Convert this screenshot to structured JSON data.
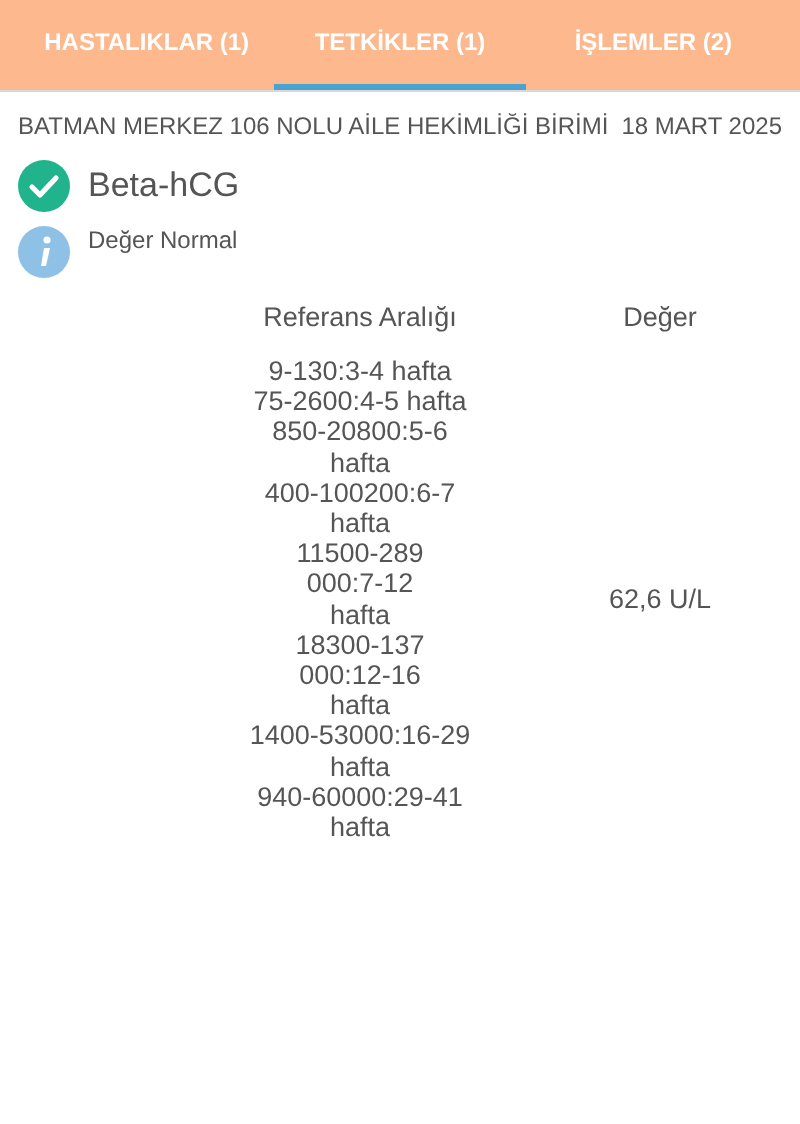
{
  "tabs": [
    {
      "label": "HASTALIKLAR (1)",
      "selected": false
    },
    {
      "label": "TETKİKLER (1)",
      "selected": true
    },
    {
      "label": "İŞLEMLER (2)",
      "selected": false
    }
  ],
  "facility": "BATMAN MERKEZ 106 NOLU AİLE HEKİMLİĞİ BİRİMİ",
  "date": "18 MART 2025",
  "test": {
    "name": "Beta-hCG",
    "status": "Değer Normal"
  },
  "table": {
    "columns": [
      "Referans Aralığı",
      "Değer"
    ],
    "reference_lines": [
      "9-130:3-4 hafta",
      "75-2600:4-5 hafta",
      "850-20800:5-6",
      "hafta",
      "400-100200:6-7",
      "hafta",
      "11500-289",
      "000:7-12",
      "hafta",
      "18300-137",
      "000:12-16",
      "hafta",
      "1400-53000:16-29",
      "hafta",
      "940-60000:29-41",
      "hafta"
    ],
    "value": "62,6 U/L"
  }
}
